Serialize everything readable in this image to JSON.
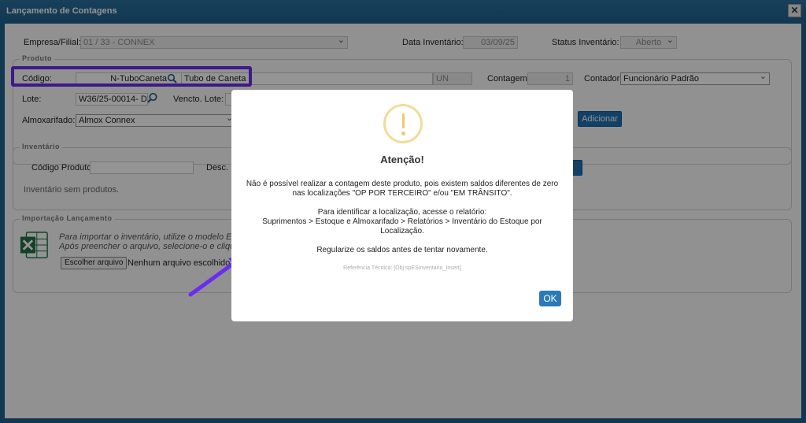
{
  "window": {
    "title": "Lançamento de Contagens",
    "close_label": "✕"
  },
  "header": {
    "empresa_label": "Empresa/Filial:",
    "empresa_value": "01 / 33 - CONNEX",
    "data_label": "Data Inventário:",
    "data_value": "03/09/25",
    "status_label": "Status Inventário:",
    "status_value": "Aberto"
  },
  "produto": {
    "legend": "Produto",
    "codigo_label": "Código:",
    "codigo_value": "N-TuboCaneta",
    "descricao_value": "Tubo de Caneta",
    "unidade_value": "UN",
    "contagem_label": "Contagem:",
    "contagem_value": "1",
    "contador_label": "Contador:",
    "contador_value": "Funcionário Padrão",
    "lote_label": "Lote:",
    "lote_value": "W36/25-00014- D",
    "vencto_label": "Vencto. Lote:",
    "almox_label": "Almoxarifado:",
    "almox_value": "Almox Connex",
    "adicionar_label": "Adicionar"
  },
  "inventario": {
    "legend": "Inventário",
    "codigo_produto_label": "Código Produto:",
    "desc_label": "Desc. P",
    "empty_text": "Inventário sem produtos."
  },
  "importacao": {
    "legend": "Importação Lançamento",
    "line1": "Para importar o inventário, utilize o modelo Exc",
    "line2": "Após preencher o arquivo, selecione-o e clique e",
    "file_button": "Escolher arquivo",
    "file_status": "Nenhum arquivo escolhido"
  },
  "modal": {
    "title": "Atenção!",
    "line1": "Não é possível realizar a contagem deste produto, pois existem saldos diferentes de zero",
    "line2": "nas localizações \"OP POR TERCEIRO\" e/ou \"EM TRÂNSITO\".",
    "line3": "Para identificar a localização, acesse o relatório:",
    "line4": "Suprimentos > Estoque e Almoxarifado > Relatórios > Inventário do Estoque por",
    "line5": "Localização.",
    "line6": "Regularize os saldos antes de tentar novamente.",
    "reference": "Referência Técnica: [Obj:spESInventario_Insert]",
    "ok_label": "OK"
  },
  "colors": {
    "highlight": "#6a2cf0",
    "arrow": "#6a2cf0",
    "primary_button": "#1f6fb2",
    "warning": "#f2c66e"
  }
}
